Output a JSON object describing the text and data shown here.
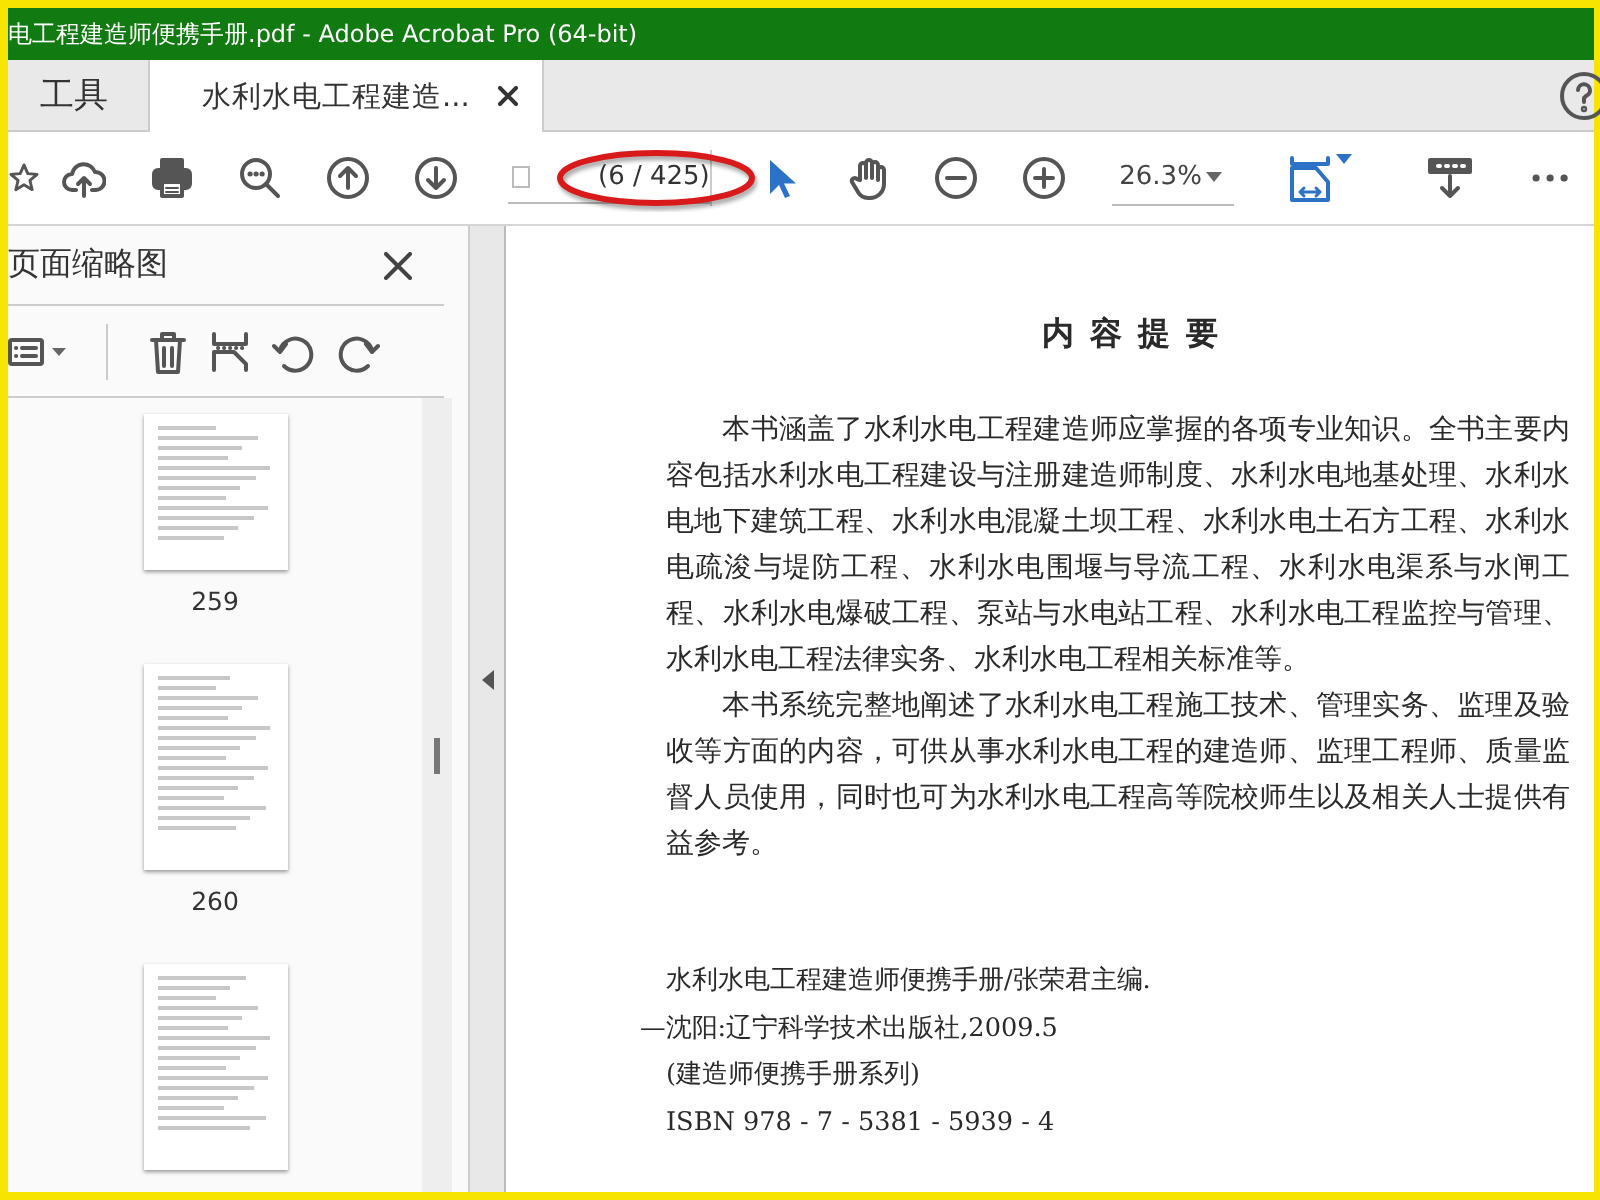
{
  "window": {
    "title": "电工程建造师便携手册.pdf - Adobe Acrobat Pro (64-bit)"
  },
  "tabs": [
    {
      "label": "工具",
      "selected": false
    },
    {
      "label": "水利水电工程建造...",
      "selected": true
    }
  ],
  "toolbar": {
    "page_field": {
      "value": "(6 / 425)"
    },
    "tools": [
      {
        "kind": "select",
        "selected": true
      },
      {
        "kind": "hand",
        "selected": false
      }
    ],
    "zoom": {
      "value": "26.3%"
    }
  },
  "thumbnail_panel": {
    "title": "页面缩略图",
    "thumbnails": [
      {
        "label": "259",
        "selected": false
      },
      {
        "label": "260",
        "selected": false
      },
      {
        "selected": false
      }
    ]
  },
  "document": {
    "heading": "内容提要",
    "paragraphs": [
      "本书涵盖了水利水电工程建造师应掌握的各项专业知识。全书主要内容包括水利水电工程建设与注册建造师制度、水利水电地基处理、水利水电地下建筑工程、水利水电混凝土坝工程、水利水电土石方工程、水利水电疏浚与堤防工程、水利水电围堰与导流工程、水利水电渠系与水闸工程、水利水电爆破工程、泵站与水电站工程、水利水电工程监控与管理、水利水电工程法律实务、水利水电工程相关标准等。",
      "本书系统完整地阐述了水利水电工程施工技术、管理实务、监理及验收等方面的内容，可供从事水利水电工程的建造师、监理工程师、质量监督人员使用，同时也可为水利水电工程高等院校师生以及相关人士提供有益参考。"
    ],
    "catalog_lines": [
      "水利水电工程建造师便携手册/张荣君主编.",
      "—沈阳:辽宁科学技术出版社,2009.5",
      "(建造师便携手册系列)",
      "ISBN 978 - 7 - 5381 - 5939 - 4"
    ]
  }
}
